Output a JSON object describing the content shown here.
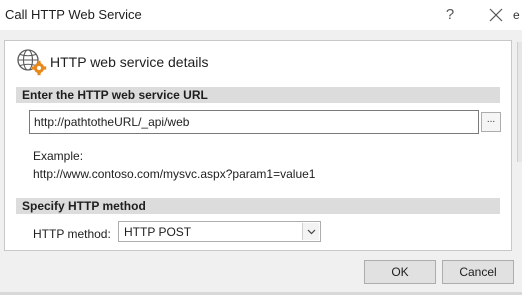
{
  "window": {
    "title": "Call HTTP Web Service",
    "help_glyph": "?",
    "edge_glyph": "e"
  },
  "panel": {
    "title": "HTTP web service details",
    "icon": "globe-gear-icon"
  },
  "url_section": {
    "heading": "Enter the HTTP web service URL",
    "url_value": "http://pathtotheURL/_api/web",
    "browse_label": "...",
    "example_label": "Example:",
    "example_value": "http://www.contoso.com/mysvc.aspx?param1=value1"
  },
  "method_section": {
    "heading": "Specify HTTP method",
    "label": "HTTP method:",
    "selected": "HTTP POST"
  },
  "buttons": {
    "ok": "OK",
    "cancel": "Cancel"
  },
  "colors": {
    "section_bar": "#dcdcdc",
    "globe": "#5a5a5a",
    "gear": "#e8891c"
  }
}
